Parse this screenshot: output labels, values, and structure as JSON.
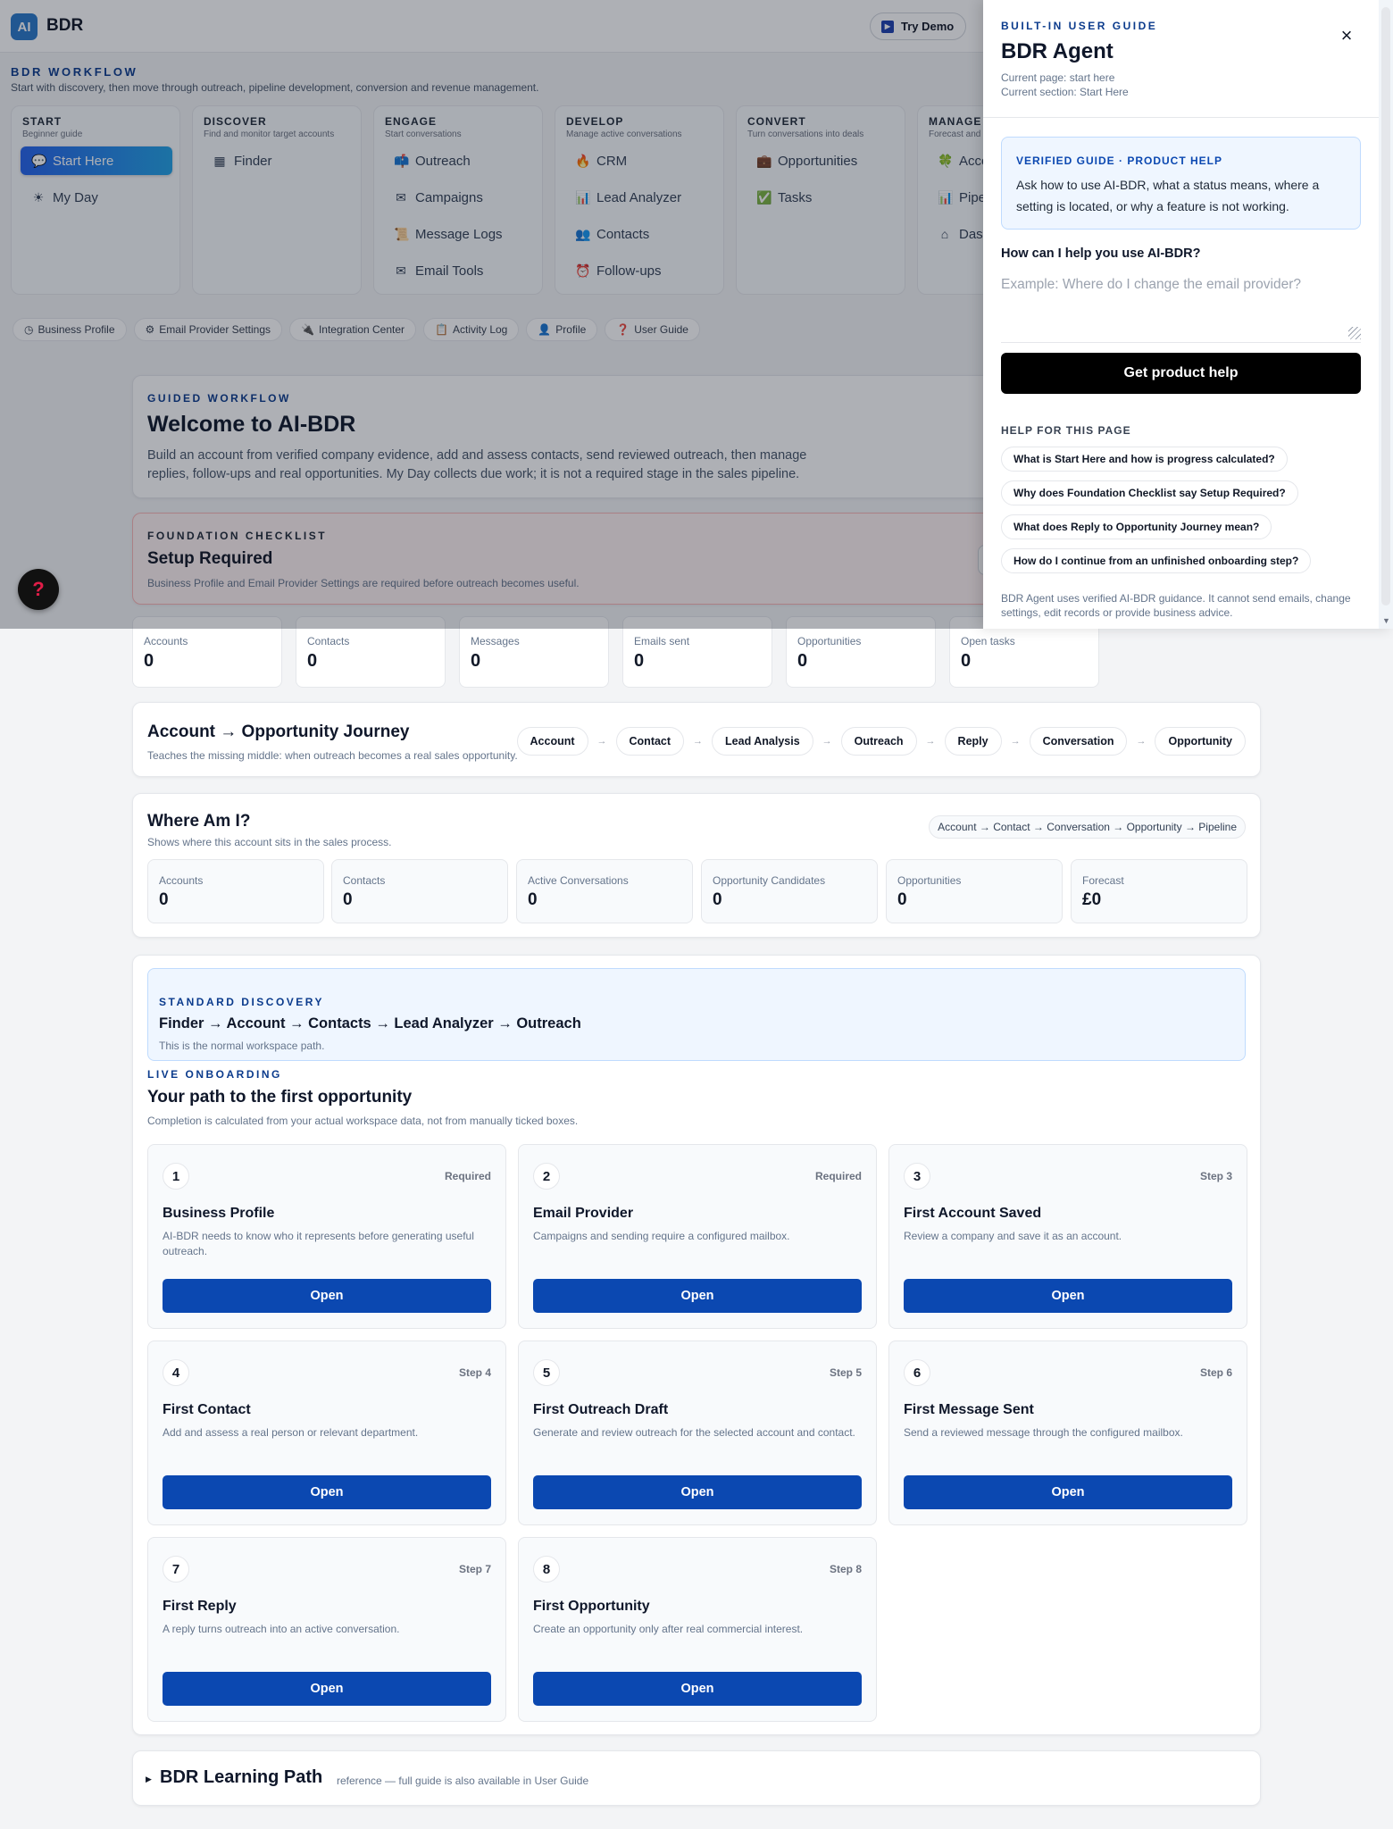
{
  "header": {
    "logo_mark": "AI",
    "logo_text": "BDR",
    "try_demo": "Try Demo"
  },
  "workflow": {
    "title": "BDR WORKFLOW",
    "subtitle": "Start with discovery, then move through outreach, pipeline development, conversion and revenue management.",
    "stages": [
      {
        "title": "START",
        "subtitle": "Beginner guide",
        "items": [
          {
            "label": "Start Here",
            "icon": "chat-bubble-icon",
            "glyph": "💬",
            "active": true
          },
          {
            "label": "My Day",
            "icon": "sun-icon",
            "glyph": "☀"
          }
        ]
      },
      {
        "title": "DISCOVER",
        "subtitle": "Find and monitor target accounts",
        "items": [
          {
            "label": "Finder",
            "icon": "grid-icon",
            "glyph": "▦"
          }
        ]
      },
      {
        "title": "ENGAGE",
        "subtitle": "Start conversations",
        "items": [
          {
            "label": "Outreach",
            "icon": "mailbox-icon",
            "glyph": "📫"
          },
          {
            "label": "Campaigns",
            "icon": "envelope-icon",
            "glyph": "✉"
          },
          {
            "label": "Message Logs",
            "icon": "scroll-icon",
            "glyph": "📜"
          },
          {
            "label": "Email Tools",
            "icon": "envelope-outline-icon",
            "glyph": "✉"
          }
        ]
      },
      {
        "title": "DEVELOP",
        "subtitle": "Manage active conversations",
        "items": [
          {
            "label": "CRM",
            "icon": "flame-icon",
            "glyph": "🔥"
          },
          {
            "label": "Lead Analyzer",
            "icon": "bar-chart-icon",
            "glyph": "📊"
          },
          {
            "label": "Contacts",
            "icon": "people-icon",
            "glyph": "👥"
          },
          {
            "label": "Follow-ups",
            "icon": "alarm-clock-icon",
            "glyph": "⏰"
          }
        ]
      },
      {
        "title": "CONVERT",
        "subtitle": "Turn conversations into deals",
        "items": [
          {
            "label": "Opportunities",
            "icon": "briefcase-icon",
            "glyph": "💼"
          },
          {
            "label": "Tasks",
            "icon": "checkbox-icon",
            "glyph": "✅"
          }
        ]
      },
      {
        "title": "MANAGE",
        "subtitle": "Forecast and",
        "items": [
          {
            "label": "Acco",
            "icon": "clover-icon",
            "glyph": "🍀"
          },
          {
            "label": "Pipel",
            "icon": "bar-chart-icon",
            "glyph": "📊"
          },
          {
            "label": "Dash",
            "icon": "home-icon",
            "glyph": "⌂"
          }
        ]
      }
    ]
  },
  "quick_links": [
    {
      "label": "Business Profile",
      "icon": "clock-icon",
      "glyph": "◷"
    },
    {
      "label": "Email Provider Settings",
      "icon": "gear-icon",
      "glyph": "⚙"
    },
    {
      "label": "Integration Center",
      "icon": "plug-icon",
      "glyph": "🔌"
    },
    {
      "label": "Activity Log",
      "icon": "clipboard-icon",
      "glyph": "📋"
    },
    {
      "label": "Profile",
      "icon": "user-icon",
      "glyph": "👤"
    },
    {
      "label": "User Guide",
      "icon": "question-icon",
      "glyph": "❓"
    }
  ],
  "welcome": {
    "label": "GUIDED WORKFLOW",
    "title": "Welcome to AI-BDR",
    "body": "Build an account from verified company evidence, add and assess contacts, send reviewed outreach, then manage replies, follow-ups and real opportunities. My Day collects due work; it is not a required stage in the sales pipeline."
  },
  "foundation": {
    "label": "FOUNDATION CHECKLIST",
    "title": "Setup Required",
    "body": "Business Profile and Email Provider Settings are required before outreach becomes useful."
  },
  "metrics": [
    {
      "label": "Accounts",
      "value": "0"
    },
    {
      "label": "Contacts",
      "value": "0"
    },
    {
      "label": "Messages",
      "value": "0"
    },
    {
      "label": "Emails sent",
      "value": "0"
    },
    {
      "label": "Opportunities",
      "value": "0"
    },
    {
      "label": "Open tasks",
      "value": "0"
    }
  ],
  "journey": {
    "title": "Account → Opportunity Journey",
    "subtitle": "Teaches the missing middle: when outreach becomes a real sales opportunity.",
    "arrow": "→",
    "steps": [
      "Account",
      "Contact",
      "Lead Analysis",
      "Outreach",
      "Reply",
      "Conversation",
      "Opportunity"
    ]
  },
  "where": {
    "title": "Where Am I?",
    "subtitle": "Shows where this account sits in the sales process.",
    "path": "Account → Contact → Conversation → Opportunity → Pipeline",
    "metrics": [
      {
        "label": "Accounts",
        "value": "0"
      },
      {
        "label": "Contacts",
        "value": "0"
      },
      {
        "label": "Active Conversations",
        "value": "0"
      },
      {
        "label": "Opportunity Candidates",
        "value": "0"
      },
      {
        "label": "Opportunities",
        "value": "0"
      },
      {
        "label": "Forecast",
        "value": "£0"
      }
    ]
  },
  "standard": {
    "label": "STANDARD DISCOVERY",
    "title": "Finder → Account → Contacts → Lead Analyzer → Outreach",
    "subtitle": "This is the normal workspace path."
  },
  "onboarding": {
    "label": "LIVE ONBOARDING",
    "title": "Your path to the first opportunity",
    "subtitle": "Completion is calculated from your actual workspace data, not from manually ticked boxes.",
    "button_label": "Open",
    "steps": [
      {
        "num": "1",
        "tag": "Required",
        "title": "Business Profile",
        "desc": "AI-BDR needs to know who it represents before generating useful outreach."
      },
      {
        "num": "2",
        "tag": "Required",
        "title": "Email Provider",
        "desc": "Campaigns and sending require a configured mailbox."
      },
      {
        "num": "3",
        "tag": "Step 3",
        "title": "First Account Saved",
        "desc": "Review a company and save it as an account."
      },
      {
        "num": "4",
        "tag": "Step 4",
        "title": "First Contact",
        "desc": "Add and assess a real person or relevant department."
      },
      {
        "num": "5",
        "tag": "Step 5",
        "title": "First Outreach Draft",
        "desc": "Generate and review outreach for the selected account and contact."
      },
      {
        "num": "6",
        "tag": "Step 6",
        "title": "First Message Sent",
        "desc": "Send a reviewed message through the configured mailbox."
      },
      {
        "num": "7",
        "tag": "Step 7",
        "title": "First Reply",
        "desc": "A reply turns outreach into an active conversation."
      },
      {
        "num": "8",
        "tag": "Step 8",
        "title": "First Opportunity",
        "desc": "Create an opportunity only after real commercial interest."
      }
    ]
  },
  "learning": {
    "title": "BDR Learning Path",
    "note": "reference — full guide is also available in User Guide"
  },
  "help_fab": "?",
  "agent": {
    "label": "BUILT-IN USER GUIDE",
    "title": "BDR Agent",
    "page_meta": "Current page: start here",
    "section_meta": "Current section: Start Here",
    "close": "×",
    "verified_label": "VERIFIED GUIDE · PRODUCT HELP",
    "verified_text": "Ask how to use AI-BDR, what a status means, where a setting is located, or why a feature is not working.",
    "ask_label": "How can I help you use AI-BDR?",
    "ask_placeholder": "Example: Where do I change the email provider?",
    "submit": "Get product help",
    "page_help_label": "HELP FOR THIS PAGE",
    "questions": [
      "What is Start Here and how is progress calculated?",
      "Why does Foundation Checklist say Setup Required?",
      "What does Reply to Opportunity Journey mean?",
      "How do I continue from an unfinished onboarding step?"
    ],
    "footer": "BDR Agent uses verified AI-BDR guidance. It cannot send emails, change settings, edit records or provide business advice."
  },
  "colors": {
    "brand": "#0b48b1",
    "accent": "#2563eb",
    "label": "#0b3b8c",
    "warning_bg": "#fef2f2",
    "overlay": "#111827"
  }
}
